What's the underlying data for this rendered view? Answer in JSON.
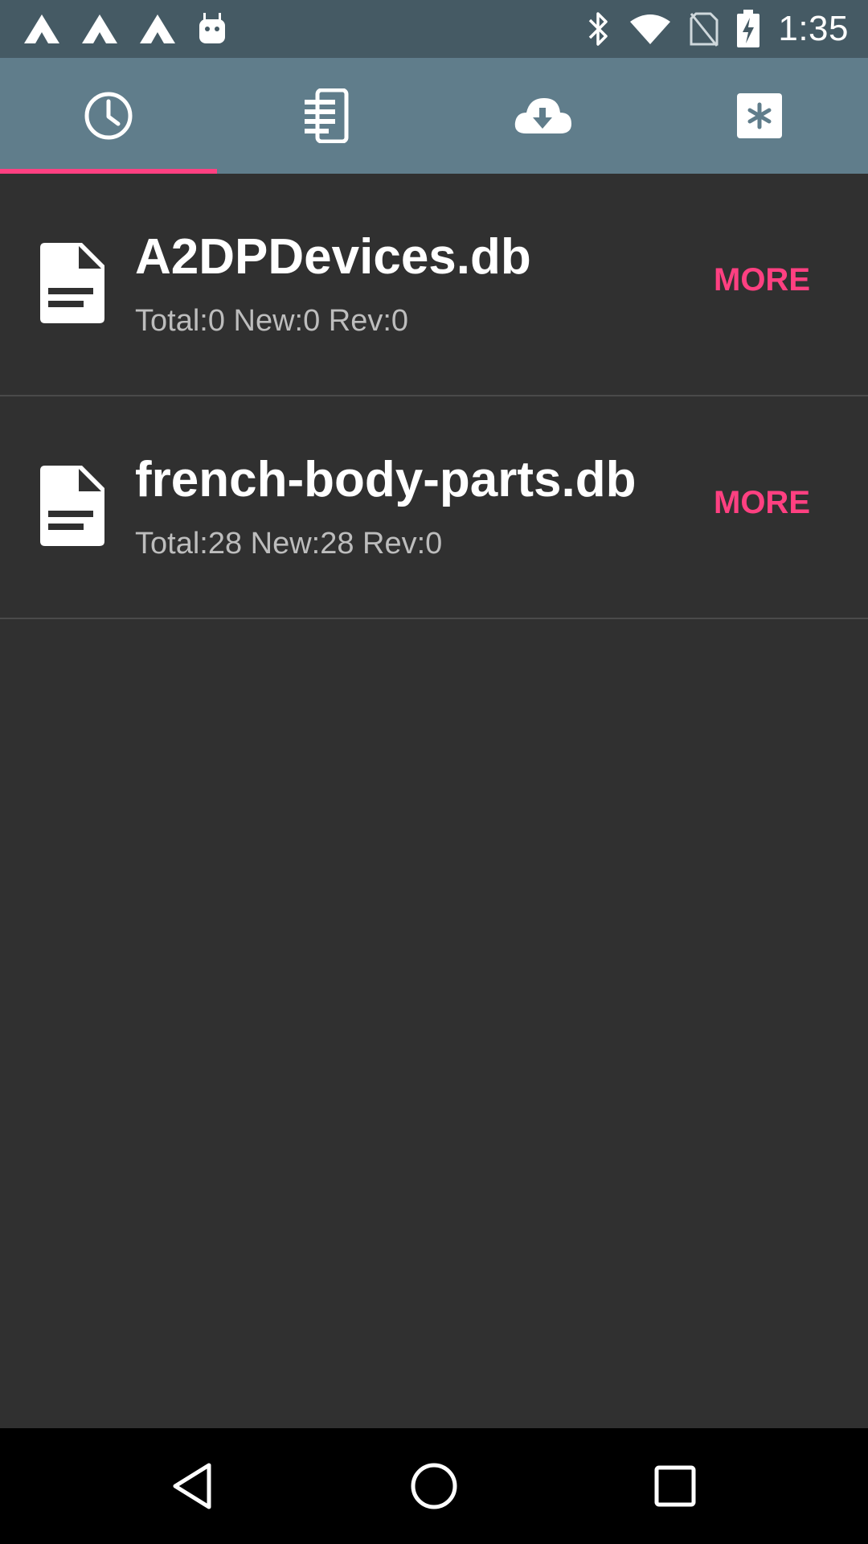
{
  "status_bar": {
    "time": "1:35",
    "notification_icons": [
      "warning-triangle-icon",
      "warning-triangle-icon",
      "warning-triangle-icon",
      "android-icon"
    ],
    "system_icons": [
      "bluetooth-icon",
      "wifi-icon",
      "no-sim-icon",
      "battery-charging-icon"
    ]
  },
  "tabs": [
    {
      "icon": "clock-icon",
      "selected": true
    },
    {
      "icon": "device-list-icon",
      "selected": false
    },
    {
      "icon": "cloud-download-icon",
      "selected": false
    },
    {
      "icon": "asterisk-icon",
      "selected": false
    }
  ],
  "decks": [
    {
      "name": "A2DPDevices.db",
      "stats": "Total:0 New:0 Rev:0",
      "action": "MORE",
      "icon": "file-icon"
    },
    {
      "name": "french-body-parts.db",
      "stats": "Total:28 New:28 Rev:0",
      "action": "MORE",
      "icon": "file-icon"
    }
  ],
  "nav_bar": {
    "buttons": [
      "back-icon",
      "home-icon",
      "recents-icon"
    ]
  },
  "colors": {
    "status_bar": "#455a64",
    "tab_bar": "#607d8b",
    "accent": "#ff4081",
    "background": "#303030",
    "divider": "#4a4a4a",
    "text_primary": "#ffffff",
    "text_secondary": "#bdbdbd"
  }
}
